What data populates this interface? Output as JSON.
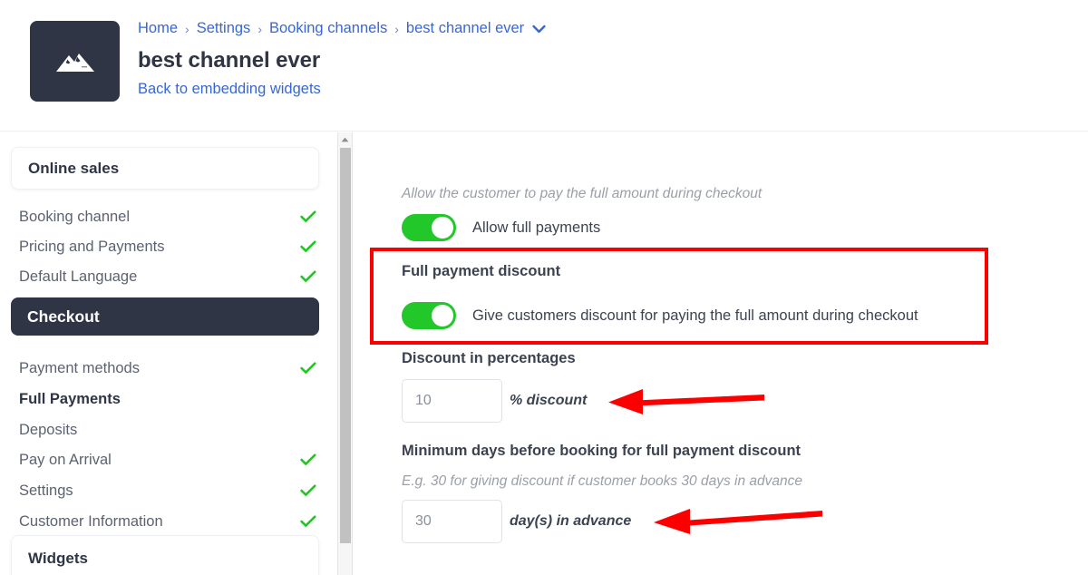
{
  "header": {
    "logo_icon": "mountain-icon",
    "breadcrumb": [
      {
        "label": "Home"
      },
      {
        "label": "Settings"
      },
      {
        "label": "Booking channels"
      },
      {
        "label": "best channel ever"
      }
    ],
    "breadcrumb_separator": "›",
    "breadcrumb_caret_icon": "chevron-down-icon",
    "title": "best channel ever",
    "back_link": "Back to embedding widgets"
  },
  "sidebar": {
    "section_online_sales": "Online sales",
    "section_widgets": "Widgets",
    "active_item": "Checkout",
    "items_top": [
      {
        "label": "Booking channel",
        "check": true
      },
      {
        "label": "Pricing and Payments",
        "check": true
      },
      {
        "label": "Default Language",
        "check": true
      }
    ],
    "items_bottom": [
      {
        "label": "Payment methods",
        "check": true,
        "bold": false
      },
      {
        "label": "Full Payments",
        "check": false,
        "bold": true
      },
      {
        "label": "Deposits",
        "check": false,
        "bold": false
      },
      {
        "label": "Pay on Arrival",
        "check": true,
        "bold": false
      },
      {
        "label": "Settings",
        "check": true,
        "bold": false
      },
      {
        "label": "Customer Information",
        "check": true,
        "bold": false
      }
    ],
    "check_icon": "check-icon",
    "check_color": "#1fc81f"
  },
  "scrollbar": {
    "up_arrow_icon": "triangle-up-icon"
  },
  "main": {
    "allow_full_payments_hint": "Allow the customer to pay the full amount during checkout",
    "allow_full_payments_label": "Allow full payments",
    "allow_full_payments_on": true,
    "full_payment_discount_title": "Full payment discount",
    "full_payment_discount_label": "Give customers discount for paying the full amount during checkout",
    "full_payment_discount_on": true,
    "discount_percentages_title": "Discount in percentages",
    "discount_value": "10",
    "discount_unit": "% discount",
    "min_days_title": "Minimum days before booking for full payment discount",
    "min_days_hint": "E.g. 30 for giving discount if customer books 30 days in advance",
    "min_days_value": "30",
    "min_days_unit": "day(s) in advance",
    "toggle_on_color": "#22c82a"
  },
  "annotations": {
    "highlight_color": "#fc0000",
    "box_target": "full-payment-discount-section",
    "arrow_1_target": "discount-percent-unit",
    "arrow_2_target": "min-days-unit"
  }
}
